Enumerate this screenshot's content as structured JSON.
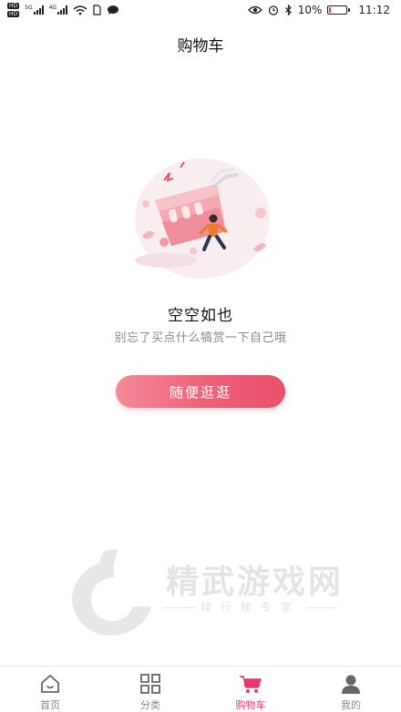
{
  "status_bar": {
    "hd1": "HD",
    "hd2": "HD",
    "net1": "5G",
    "net2": "4G",
    "battery_percent": "10%",
    "time": "11:12",
    "battery_level": 0.1,
    "battery_color": "#e8404b"
  },
  "header": {
    "title": "购物车"
  },
  "empty_state": {
    "title": "空空如也",
    "subtitle": "别忘了买点什么犒赏一下自己哦",
    "button_label": "随便逛逛"
  },
  "watermark": {
    "text": "精武游戏网",
    "subtext": "排行榜专家"
  },
  "tabs": [
    {
      "label": "首页",
      "icon": "home-icon",
      "active": false
    },
    {
      "label": "分类",
      "icon": "grid-icon",
      "active": false
    },
    {
      "label": "购物车",
      "icon": "cart-icon",
      "active": true
    },
    {
      "label": "我的",
      "icon": "user-icon",
      "active": false
    }
  ],
  "colors": {
    "accent": "#e6396a",
    "button_start": "#f48a98",
    "button_end": "#e9506c"
  }
}
